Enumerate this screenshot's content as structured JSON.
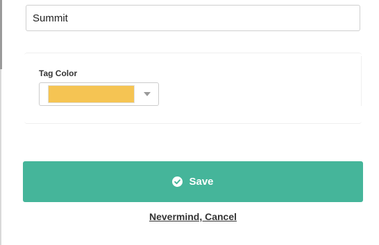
{
  "form": {
    "name_value": "Summit"
  },
  "tag_color": {
    "label": "Tag Color",
    "selected_color": "#f5c453"
  },
  "actions": {
    "save_label": "Save",
    "save_icon": "check-circle-icon",
    "save_color": "#45b59a",
    "cancel_label": "Nevermind, Cancel"
  }
}
